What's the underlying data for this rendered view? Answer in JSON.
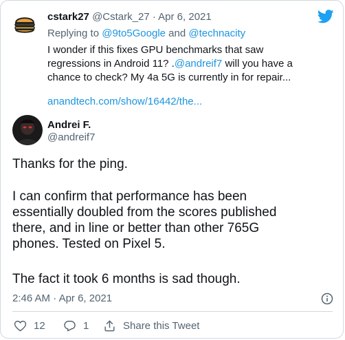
{
  "parent_tweet": {
    "author_name": "cstark27",
    "author_handle": "@Cstark_27",
    "separator": "·",
    "date": "Apr 6, 2021",
    "replying_prefix": "Replying to ",
    "replying_to_1": "@9to5Google",
    "replying_and": " and ",
    "replying_to_2": "@technacity",
    "text_line1": "I wonder if this fixes GPU benchmarks that saw",
    "text_line2_start": "regressions in Android 11? .",
    "text_line2_mention": "@andreif7",
    "text_line2_end": " will you have a",
    "text_line3": "chance to check? My 4a 5G is currently in for repair...",
    "link": "anandtech.com/show/16442/the..."
  },
  "main_tweet": {
    "author_name": "Andrei F.",
    "author_handle": "@andreif7",
    "lines": [
      "Thanks for the ping.",
      "I can confirm that performance has been",
      "essentially doubled from the scores published",
      "there, and in line or better than other 765G",
      "phones. Tested on Pixel 5.",
      "The fact it took 6 months is sad though."
    ],
    "time": "2:46 AM",
    "separator": "·",
    "date": "Apr 6, 2021"
  },
  "actions": {
    "like_count": "12",
    "reply_count": "1",
    "share_label": "Share this Tweet"
  },
  "colors": {
    "link": "#1b95e0",
    "muted": "#536471",
    "text": "#0f1419",
    "twitter_blue": "#1da1f2"
  },
  "icons": [
    "twitter-bird-icon",
    "burger-avatar-icon",
    "info-icon",
    "heart-icon",
    "reply-icon",
    "share-icon"
  ]
}
